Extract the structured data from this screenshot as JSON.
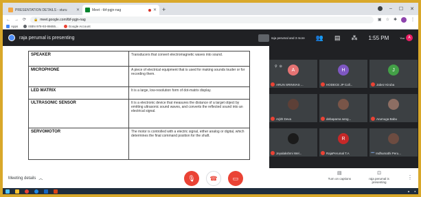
{
  "browser": {
    "tabs": [
      {
        "title": "PRESENTATION DETAILS - sturu",
        "favicon_color": "#f4a742"
      },
      {
        "title": "Meet - tbf-pgjn-nag",
        "favicon_color": "#00832d"
      }
    ],
    "new_tab": "+",
    "url": "meet.google.com/tbf-pgjn-nag",
    "bookmarks": [
      {
        "label": "Apps"
      },
      {
        "label": "ISBN 978-93-86655..."
      },
      {
        "label": "Google Account"
      }
    ]
  },
  "meet": {
    "presenter_text": "raja perumal is presenting",
    "thumbnail_label": "raja perumal and 3 more",
    "time": "1:55 PM",
    "you_label": "You",
    "you_initial": "A",
    "participants": [
      {
        "initial": "A",
        "name": "ARUN SRINIVAS ...",
        "color": "#e57373",
        "self": true
      },
      {
        "initial": "H",
        "name": "HODECE JP Coll...",
        "color": "#7e57c2"
      },
      {
        "initial": "J",
        "name": "Jabez Kiruba",
        "color": "#43a047"
      },
      {
        "initial": "",
        "name": "Arjith Deva",
        "color": "#5d4037"
      },
      {
        "initial": "",
        "name": "debaparna seng...",
        "color": "#795548"
      },
      {
        "initial": "",
        "name": "Arumuga Babu",
        "color": "#8d6e63"
      },
      {
        "initial": "",
        "name": "Jeyalakshmi Wel...",
        "color": "#1b1b1b"
      },
      {
        "initial": "R",
        "name": "RajaPerumal T.A",
        "color": "#c62828"
      },
      {
        "initial": "",
        "name": "Indhumathi Peru...",
        "color": "#6d4c41"
      }
    ],
    "meeting_details": "Meeting details",
    "captions_label": "Turn on captions",
    "presenting_label": "raja perumal is presenting"
  },
  "slide": {
    "rows": [
      {
        "term": "SPEAKER",
        "definition": "Transducers that convert electromagnetic waves into sound."
      },
      {
        "term": "MICROPHONE",
        "definition": "A piece of electrical equipment that is used for making sounds louder or for recording them."
      },
      {
        "term": "LED MATRIX",
        "definition": "It is a large, low-resolution form of dot-matrix display."
      },
      {
        "term": "ULTRASONIC SENSOR",
        "definition": "It is a electronic device that measures the distance of a target object by emitting ultrasonic sound waves, and converts the reflected sound into an electrical signal."
      },
      {
        "term": "SERVOMOTOR",
        "definition": "The motor is controlled with a electric signal, either analog or digital, which determines the final command position for the shaft."
      }
    ]
  }
}
